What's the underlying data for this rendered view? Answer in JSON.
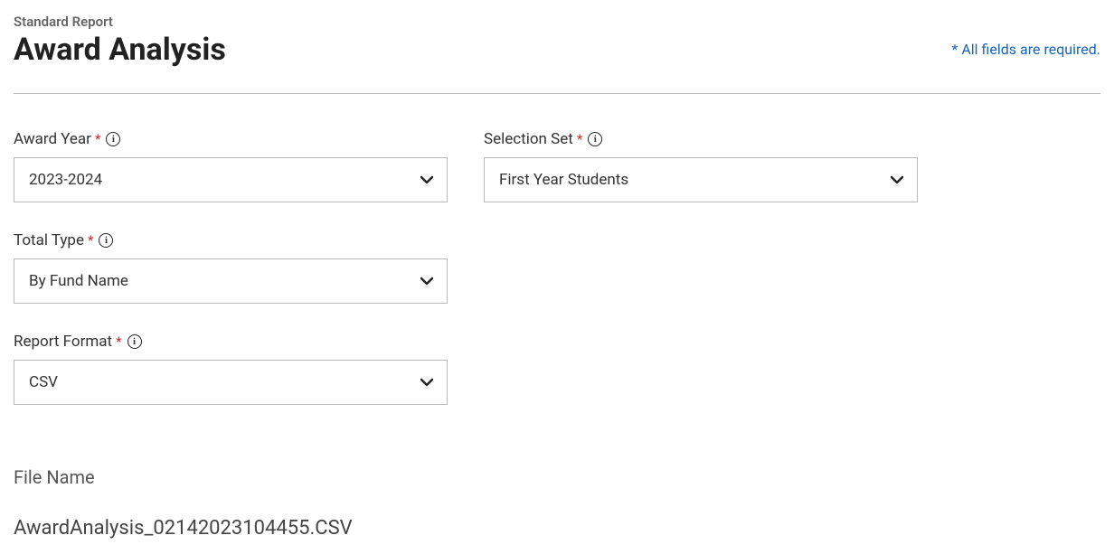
{
  "header": {
    "subtitle": "Standard Report",
    "title": "Award Analysis",
    "required_note": "* All fields are required."
  },
  "fields": {
    "award_year": {
      "label": "Award Year",
      "value": "2023-2024"
    },
    "selection_set": {
      "label": "Selection Set",
      "value": "First Year Students"
    },
    "total_type": {
      "label": "Total Type",
      "value": "By Fund Name"
    },
    "report_format": {
      "label": "Report Format",
      "value": "CSV"
    }
  },
  "file_name": {
    "label": "File Name",
    "value": "AwardAnalysis_02142023104455.CSV"
  }
}
